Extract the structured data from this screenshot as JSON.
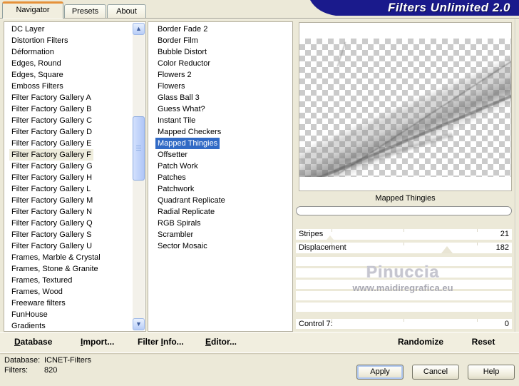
{
  "window": {
    "title": "Filters Unlimited 2.0"
  },
  "tabs": [
    {
      "label": "Navigator",
      "active": true
    },
    {
      "label": "Presets"
    },
    {
      "label": "About"
    }
  ],
  "left_list": {
    "items": [
      {
        "label": "DC Layer"
      },
      {
        "label": "Distortion Filters"
      },
      {
        "label": "Déformation"
      },
      {
        "label": "Edges, Round"
      },
      {
        "label": "Edges, Square"
      },
      {
        "label": "Emboss Filters"
      },
      {
        "label": "Filter Factory Gallery A"
      },
      {
        "label": "Filter Factory Gallery B"
      },
      {
        "label": "Filter Factory Gallery C"
      },
      {
        "label": "Filter Factory Gallery D"
      },
      {
        "label": "Filter Factory Gallery E"
      },
      {
        "label": "Filter Factory Gallery F",
        "selected": true
      },
      {
        "label": "Filter Factory Gallery G"
      },
      {
        "label": "Filter Factory Gallery H"
      },
      {
        "label": "Filter Factory Gallery L"
      },
      {
        "label": "Filter Factory Gallery M"
      },
      {
        "label": "Filter Factory Gallery N"
      },
      {
        "label": "Filter Factory Gallery Q"
      },
      {
        "label": "Filter Factory Gallery S"
      },
      {
        "label": "Filter Factory Gallery U"
      },
      {
        "label": "Frames, Marble & Crystal"
      },
      {
        "label": "Frames, Stone & Granite"
      },
      {
        "label": "Frames, Textured"
      },
      {
        "label": "Frames, Wood"
      },
      {
        "label": "Freeware filters"
      },
      {
        "label": "FunHouse"
      },
      {
        "label": "Gradients"
      }
    ]
  },
  "filter_list": {
    "items": [
      {
        "label": "Border Fade 2"
      },
      {
        "label": "Border Film"
      },
      {
        "label": "Bubble Distort"
      },
      {
        "label": "Color Reductor"
      },
      {
        "label": "Flowers 2"
      },
      {
        "label": "Flowers"
      },
      {
        "label": "Glass Ball 3"
      },
      {
        "label": "Guess What?"
      },
      {
        "label": "Instant Tile"
      },
      {
        "label": "Mapped Checkers"
      },
      {
        "label": "Mapped Thingies",
        "selected": true
      },
      {
        "label": "Offsetter"
      },
      {
        "label": "Patch Work"
      },
      {
        "label": "Patches"
      },
      {
        "label": "Patchwork"
      },
      {
        "label": "Quadrant Replicate"
      },
      {
        "label": "Radial Replicate"
      },
      {
        "label": "RGB Spirals"
      },
      {
        "label": "Scrambler"
      },
      {
        "label": "Sector Mosaic"
      }
    ]
  },
  "preview": {
    "caption": "Mapped Thingies"
  },
  "sliders": {
    "stripes": {
      "label": "Stripes",
      "value": "21",
      "thumb_left": "16%"
    },
    "displacement": {
      "label": "Displacement",
      "value": "182",
      "thumb_left": "70%"
    },
    "control7": {
      "label": "Control 7:",
      "value": "0"
    }
  },
  "watermark": {
    "line1": "Pinuccia",
    "line2": "www.maidiregrafica.eu"
  },
  "actions": {
    "randomize": "Randomize",
    "reset": "Reset"
  },
  "toolbar": {
    "items": [
      {
        "pre": "",
        "mn": "D",
        "rest": "atabase"
      },
      {
        "pre": "",
        "mn": "I",
        "rest": "mport..."
      },
      {
        "pre": "Filter ",
        "mn": "I",
        "rest": "nfo..."
      },
      {
        "pre": "",
        "mn": "E",
        "rest": "ditor..."
      }
    ]
  },
  "status": {
    "database_label": "Database:",
    "database_value": "ICNET-Filters",
    "filters_label": "Filters:",
    "filters_value": "820"
  },
  "buttons": {
    "apply": "Apply",
    "cancel": "Cancel",
    "help": "Help"
  },
  "scrollbar": {
    "up": "▲",
    "down": "▼"
  },
  "colors": {
    "title_navy": "#1A1A8C",
    "selection_blue": "#316AC5",
    "tab_orange": "#E5913A",
    "dialog_bg": "#ECE9D8"
  }
}
